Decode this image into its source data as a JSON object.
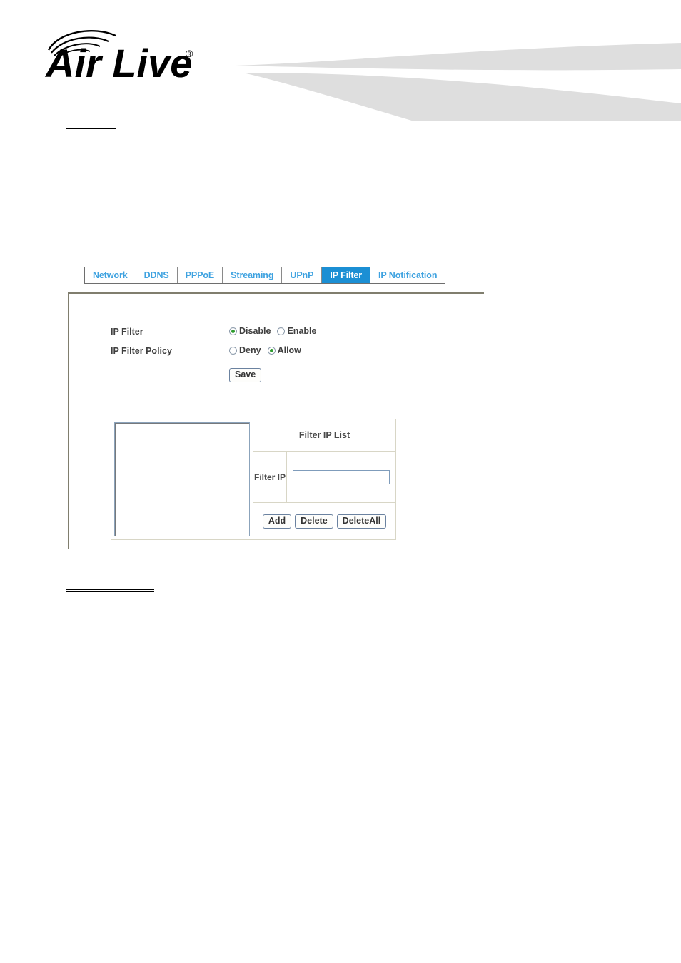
{
  "brand": {
    "name": "Air Live",
    "trademark": "®",
    "logo_icon": "airlive-wireless-logo"
  },
  "tabs": [
    {
      "label": "Network",
      "active": false
    },
    {
      "label": "DDNS",
      "active": false
    },
    {
      "label": "PPPoE",
      "active": false
    },
    {
      "label": "Streaming",
      "active": false
    },
    {
      "label": "UPnP",
      "active": false
    },
    {
      "label": "IP Filter",
      "active": true
    },
    {
      "label": "IP Notification",
      "active": false
    }
  ],
  "settings": {
    "ip_filter": {
      "label": "IP Filter",
      "options": [
        {
          "label": "Disable",
          "selected": true
        },
        {
          "label": "Enable",
          "selected": false
        }
      ]
    },
    "ip_filter_policy": {
      "label": "IP Filter Policy",
      "options": [
        {
          "label": "Deny",
          "selected": false
        },
        {
          "label": "Allow",
          "selected": true
        }
      ]
    },
    "save_label": "Save"
  },
  "filter_ip": {
    "list_header": "Filter IP List",
    "field_label": "Filter IP",
    "field_value": "",
    "field_placeholder": "",
    "list_entries": [],
    "buttons": {
      "add": "Add",
      "delete": "Delete",
      "delete_all": "DeleteAll"
    }
  },
  "colors": {
    "tab_text": "#3ea2e0",
    "tab_active_bg": "#1b8fd4",
    "tab_active_text": "#ffffff",
    "radio_selected": "#2f9c2f",
    "banner_swoosh": "#dedede",
    "panel_border": "#807e6e"
  }
}
